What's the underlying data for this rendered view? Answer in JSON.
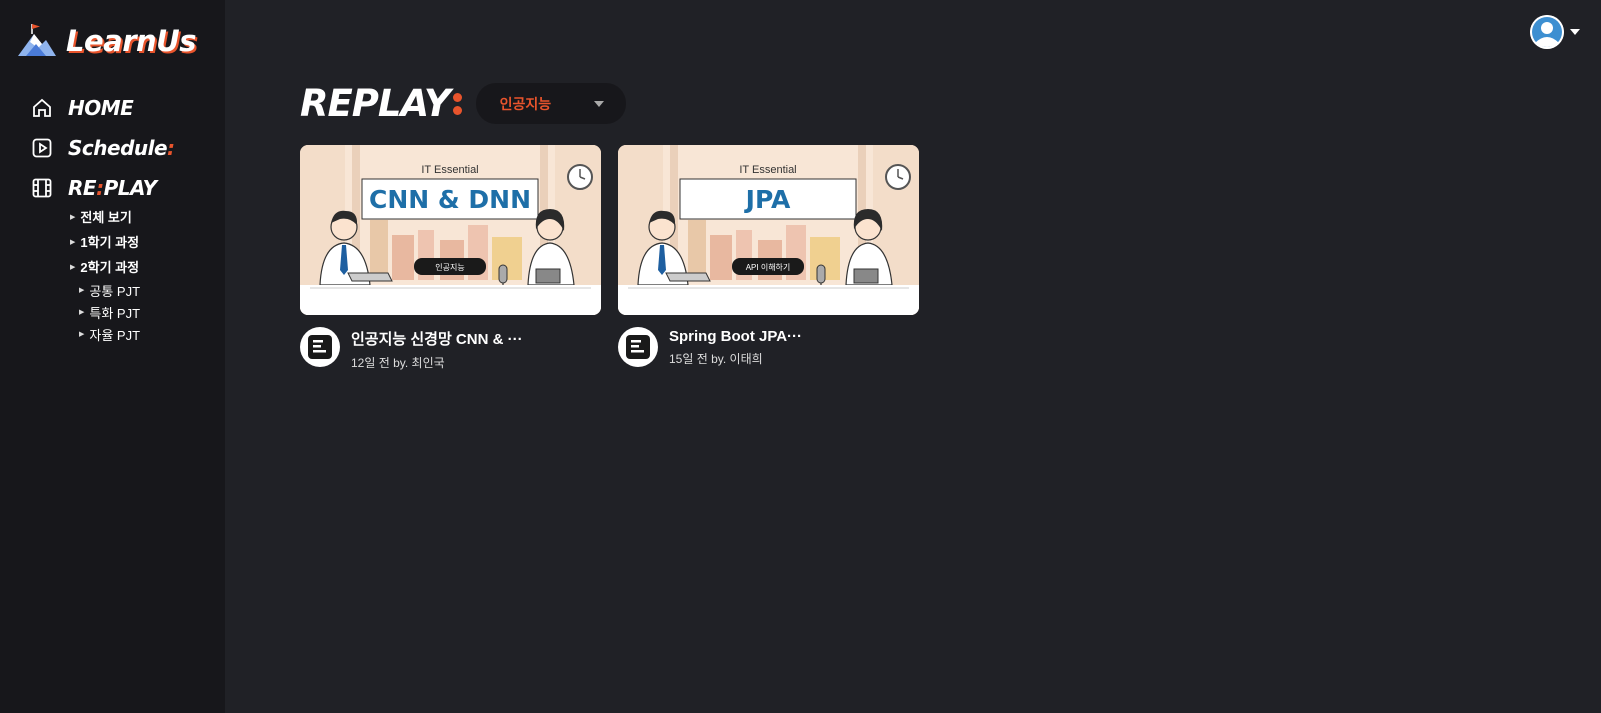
{
  "app": {
    "name": "LearnUs"
  },
  "nav": {
    "home": "HOME",
    "schedule": "Schedule",
    "schedule_colon": ":",
    "replay_prefix": "RE",
    "replay_colon": ":",
    "replay_suffix": "PLAY"
  },
  "subnav": {
    "all": "전체 보기",
    "sem1": "1학기 과정",
    "sem2": "2학기 과정",
    "sem2_children": [
      "공통 PJT",
      "특화 PJT",
      "자율 PJT"
    ]
  },
  "page": {
    "title": "REPLAY",
    "filter_value": "인공지능"
  },
  "videos": [
    {
      "thumb_header": "IT Essential",
      "thumb_title": "CNN & DNN",
      "thumb_tag": "인공지능",
      "title": "인공지능 신경망 CNN & ···",
      "subtitle": "12일 전 by. 최인국"
    },
    {
      "thumb_header": "IT Essential",
      "thumb_title": "JPA",
      "thumb_tag": "API 이해하기",
      "title": "Spring Boot JPA···",
      "subtitle": "15일 전 by. 이태희"
    }
  ],
  "colors": {
    "accent": "#e8542c",
    "bg": "#202126",
    "sidebar": "#17171b",
    "thumb_title": "#1e6fa8"
  },
  "icons": [
    "logo-mountain-icon",
    "home-icon",
    "play-square-icon",
    "film-icon",
    "user-avatar-icon",
    "caret-down-icon"
  ]
}
